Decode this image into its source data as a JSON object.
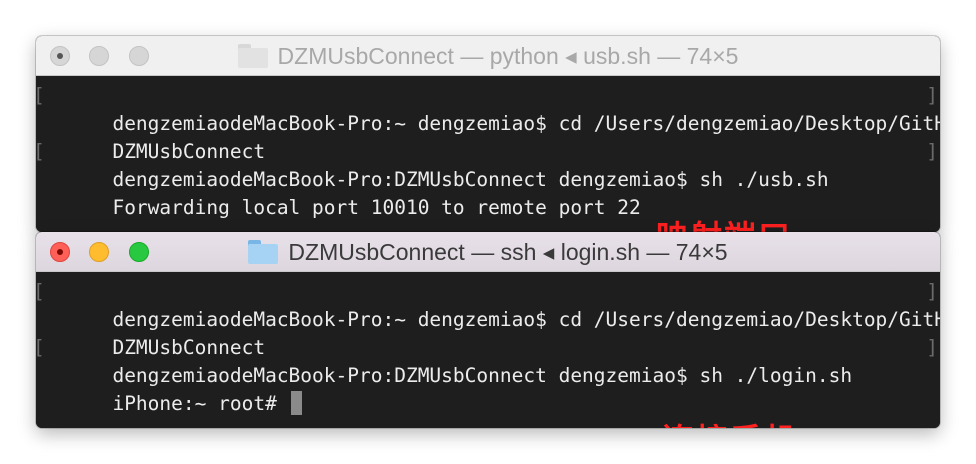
{
  "colors": {
    "annotation": "#ff2020",
    "terminal_bg": "#1e1e1e",
    "terminal_text": "#ececec",
    "traffic_close": "#fe5f57",
    "traffic_minimize": "#febc2e",
    "traffic_zoom": "#28c840"
  },
  "windows": [
    {
      "title": "DZMUsbConnect — python ◂ usb.sh — 74×5",
      "lines": [
        "dengzemiaodeMacBook-Pro:~ dengzemiao$ cd /Users/dengzemiao/Desktop/GitHub/",
        "DZMUsbConnect",
        "dengzemiaodeMacBook-Pro:DZMUsbConnect dengzemiao$ sh ./usb.sh",
        "Forwarding local port 10010 to remote port 22"
      ],
      "annotation": "映射端口"
    },
    {
      "title": "DZMUsbConnect — ssh ◂ login.sh — 74×5",
      "lines": [
        "dengzemiaodeMacBook-Pro:~ dengzemiao$ cd /Users/dengzemiao/Desktop/GitHub/",
        "DZMUsbConnect",
        "dengzemiaodeMacBook-Pro:DZMUsbConnect dengzemiao$ sh ./login.sh",
        "iPhone:~ root# "
      ],
      "annotation": "连接手机"
    }
  ]
}
